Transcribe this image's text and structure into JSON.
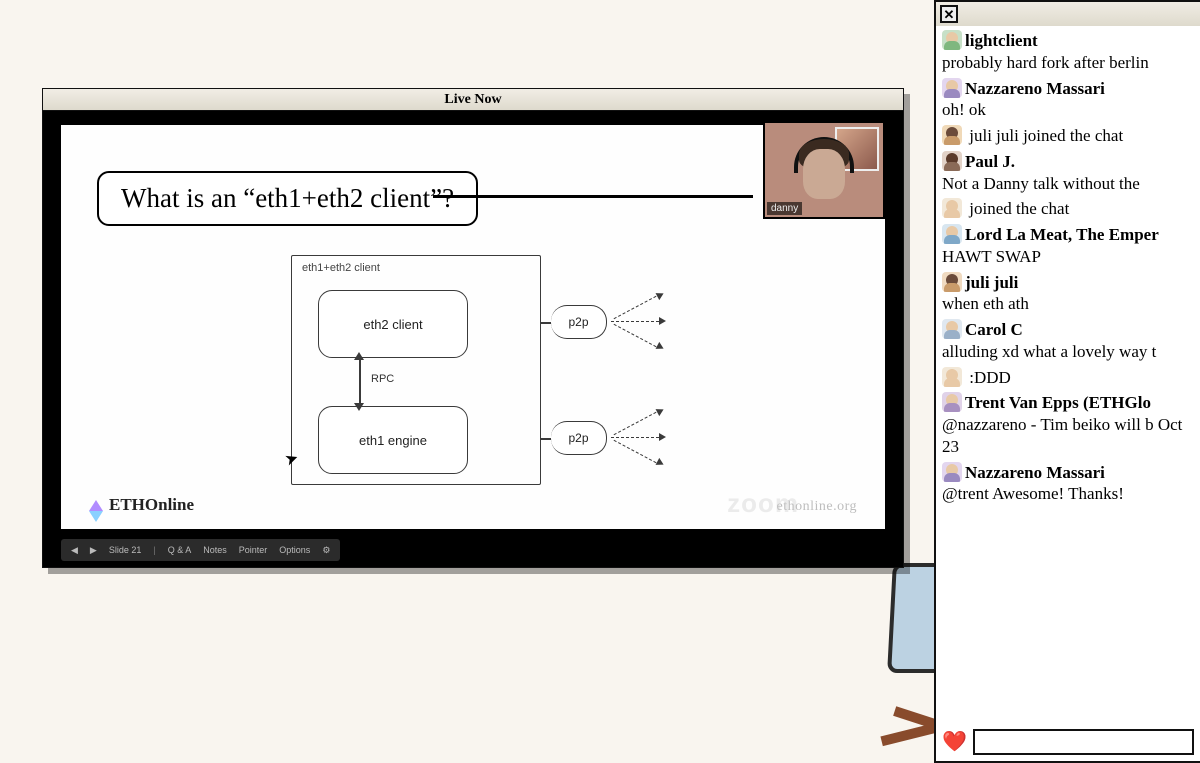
{
  "video": {
    "title": "Live Now",
    "slide_title": "What is an “eth1+eth2 client”?",
    "diagram_label": "eth1+eth2 client",
    "box_top": "eth2 client",
    "box_bot": "eth1 engine",
    "p2p": "p2p",
    "rpc": "RPC",
    "brand": "ETHOnline",
    "url": "ethonline.org",
    "zoom": "zoom",
    "toolbar": {
      "prev": "◀",
      "play": "▶",
      "slide": "Slide 21",
      "qna": "Q & A",
      "notes": "Notes",
      "pointer": "Pointer",
      "options": "Options",
      "gear": "⚙"
    },
    "presenter": "danny"
  },
  "chat": {
    "close": "✕",
    "messages": [
      {
        "avatar": "",
        "name": "lightclient",
        "text": "probably hard fork after berlin"
      },
      {
        "avatar": "v1",
        "name": "Nazzareno Massari",
        "text": "oh! ok"
      },
      {
        "avatar": "v2",
        "name": "",
        "text": "juli juli joined the chat"
      },
      {
        "avatar": "v3",
        "name": "Paul J.",
        "text": "Not a Danny talk without the"
      },
      {
        "avatar": "v4",
        "name": "",
        "text": "joined the chat"
      },
      {
        "avatar": "v5",
        "name": "Lord La Meat, The Emper",
        "text": "HAWT SWAP"
      },
      {
        "avatar": "v6",
        "name": "juli juli",
        "text": "when eth ath"
      },
      {
        "avatar": "v7",
        "name": "Carol C",
        "text": "alluding xd what a lovely way t"
      },
      {
        "avatar": "v4",
        "name": "",
        "text": ":DDD"
      },
      {
        "avatar": "v8",
        "name": "Trent Van Epps (ETHGlo",
        "text": "@nazzareno - Tim beiko will b Oct 23"
      },
      {
        "avatar": "v1",
        "name": "Nazzareno Massari",
        "text": "@trent Awesome! Thanks!"
      }
    ],
    "heart": "❤️",
    "placeholder": ""
  }
}
